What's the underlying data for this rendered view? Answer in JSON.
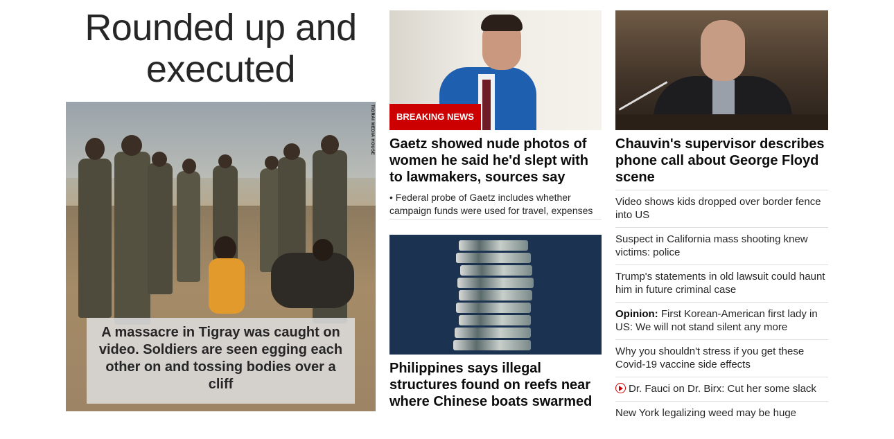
{
  "lead": {
    "headline": "Rounded up and executed",
    "caption": "A massacre in Tigray was caught on video. Soldiers are seen egging each other on and tossing bodies over a cliff",
    "image_credit": "TIGRAI MEDIA HOUSE"
  },
  "column2": {
    "story1": {
      "badge": "BREAKING NEWS",
      "title": "Gaetz showed nude photos of women he said he'd slept with to lawmakers, sources say",
      "bullet": "• Federal probe of Gaetz includes whether campaign funds were used for travel, expenses"
    },
    "story2": {
      "title": "Philippines says illegal structures found on reefs near where Chinese boats swarmed"
    }
  },
  "column3": {
    "story1": {
      "title": "Chauvin's supervisor describes phone call about George Floyd scene"
    },
    "list": [
      {
        "prefix": "",
        "text": "Video shows kids dropped over border fence into US"
      },
      {
        "prefix": "",
        "text": "Suspect in California mass shooting knew victims: police"
      },
      {
        "prefix": "",
        "text": "Trump's statements in old lawsuit could haunt him in future criminal case"
      },
      {
        "prefix": "Opinion:",
        "text": " First Korean-American first lady in US: We will not stand silent any more"
      },
      {
        "prefix": "",
        "text": "Why you shouldn't stress if you get these Covid-19 vaccine side effects"
      },
      {
        "prefix": "",
        "text": "Dr. Fauci on Dr. Birx: Cut her some slack",
        "icon": "play-icon"
      },
      {
        "prefix": "",
        "text": "New York legalizing weed may be huge"
      }
    ]
  },
  "colors": {
    "accent": "#cc0000",
    "text": "#0c0c0c"
  }
}
